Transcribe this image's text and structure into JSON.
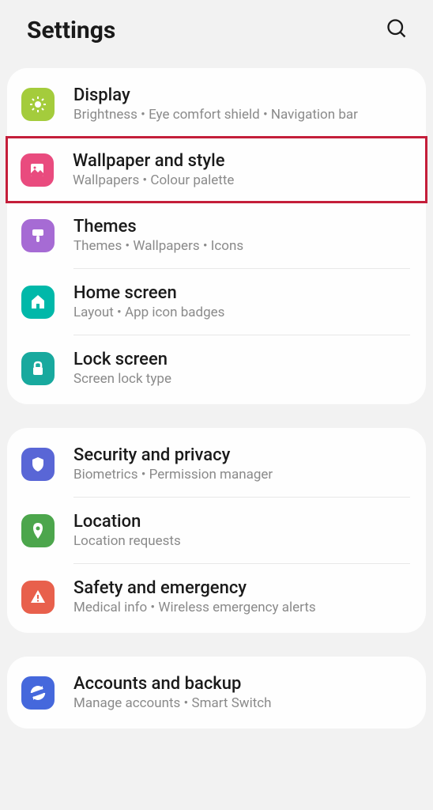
{
  "header": {
    "title": "Settings"
  },
  "groups": [
    {
      "items": [
        {
          "title": "Display",
          "subtitle": "Brightness  •  Eye comfort shield  •  Navigation bar",
          "icon": "sun-icon",
          "color": "bg-lime",
          "highlighted": false
        },
        {
          "title": "Wallpaper and style",
          "subtitle": "Wallpapers  •  Colour palette",
          "icon": "picture-icon",
          "color": "bg-pink",
          "highlighted": true
        },
        {
          "title": "Themes",
          "subtitle": "Themes  •  Wallpapers  •  Icons",
          "icon": "brush-icon",
          "color": "bg-purple",
          "highlighted": false
        },
        {
          "title": "Home screen",
          "subtitle": "Layout  •  App icon badges",
          "icon": "home-icon",
          "color": "bg-teal",
          "highlighted": false
        },
        {
          "title": "Lock screen",
          "subtitle": "Screen lock type",
          "icon": "lock-icon",
          "color": "bg-teal2",
          "highlighted": false
        }
      ]
    },
    {
      "items": [
        {
          "title": "Security and privacy",
          "subtitle": "Biometrics  •  Permission manager",
          "icon": "shield-icon",
          "color": "bg-indigo",
          "highlighted": false
        },
        {
          "title": "Location",
          "subtitle": "Location requests",
          "icon": "pin-icon",
          "color": "bg-green",
          "highlighted": false
        },
        {
          "title": "Safety and emergency",
          "subtitle": "Medical info  •  Wireless emergency alerts",
          "icon": "warning-icon",
          "color": "bg-red",
          "highlighted": false
        }
      ]
    },
    {
      "items": [
        {
          "title": "Accounts and backup",
          "subtitle": "Manage accounts  •  Smart Switch",
          "icon": "sync-icon",
          "color": "bg-blue",
          "highlighted": false
        }
      ]
    }
  ]
}
